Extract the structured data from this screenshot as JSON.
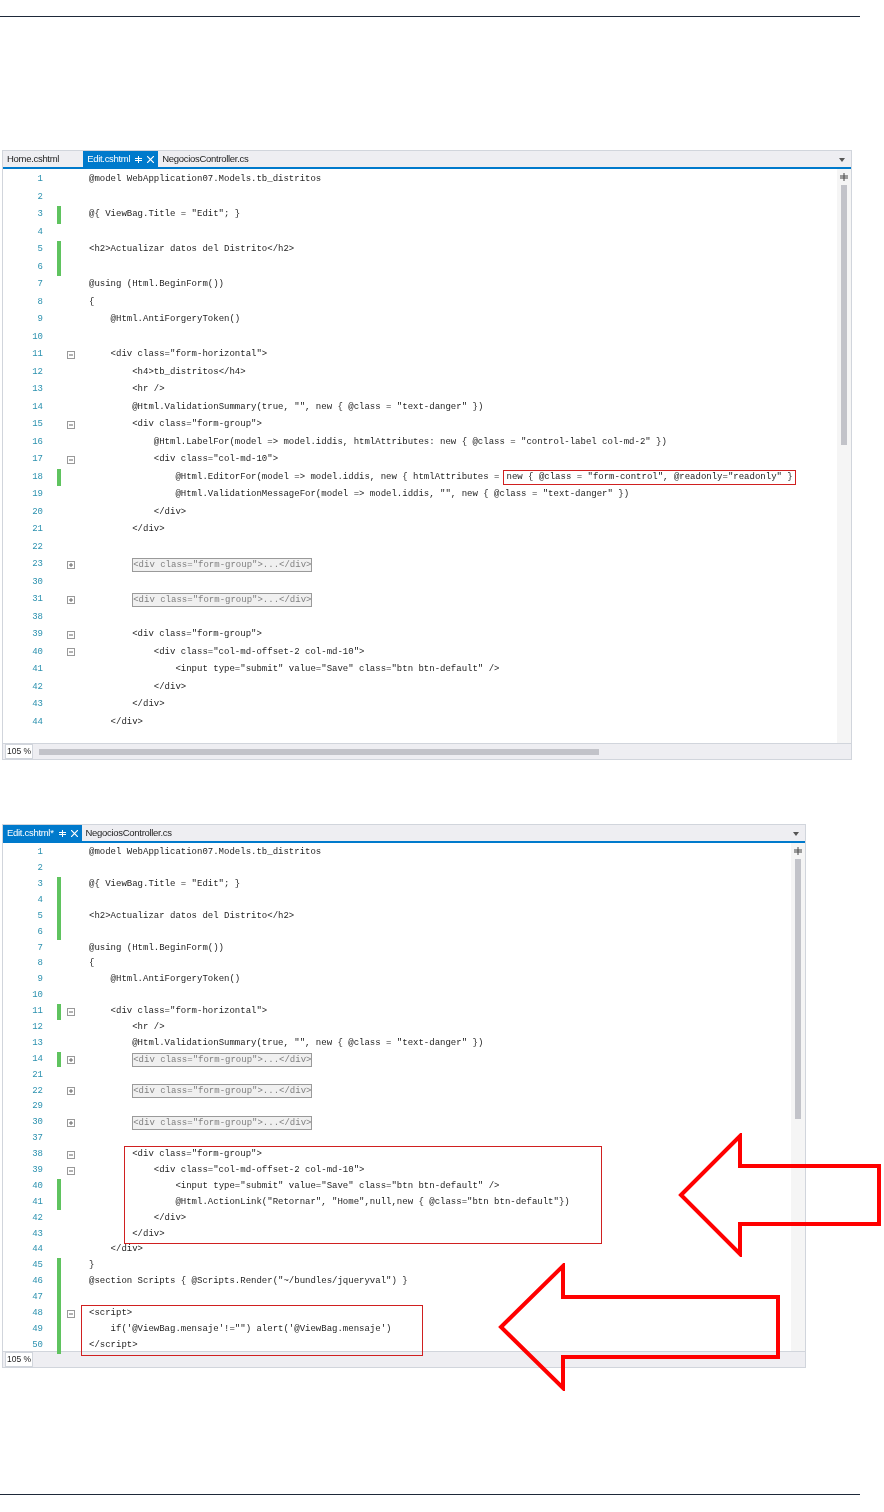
{
  "editors": [
    {
      "tabs": [
        {
          "label": "Home.cshtml",
          "selected": false
        },
        {
          "label": "Edit.cshtml",
          "selected": true
        },
        {
          "label": "NegociosController.cs",
          "selected": false
        }
      ],
      "lines": [
        {
          "num": "1",
          "text": "@model WebApplication07.Models.tb_distritos",
          "changed": false,
          "boxed": false
        },
        {
          "num": "2",
          "changed": false,
          "boxed": false
        },
        {
          "num": "3",
          "text": "@{ ViewBag.Title = \"Edit\"; }",
          "changed": true,
          "boxed": false
        },
        {
          "num": "4",
          "changed": false,
          "boxed": false
        },
        {
          "num": "5",
          "text": "<h2>Actualizar datos del Distrito</h2>",
          "changed": true,
          "boxed": false
        },
        {
          "num": "6",
          "changed": true,
          "boxed": false
        },
        {
          "num": "7",
          "text": "@using (Html.BeginForm())",
          "changed": false,
          "boxed": false
        },
        {
          "num": "8",
          "text": "{",
          "changed": false,
          "boxed": false
        },
        {
          "num": "9",
          "text": "    @Html.AntiForgeryToken()",
          "changed": false,
          "boxed": false
        },
        {
          "num": "10",
          "changed": false,
          "boxed": false
        },
        {
          "num": "11",
          "text": "    <div class=\"form-horizontal\">",
          "changed": false,
          "collapsed": false,
          "boxed": false
        },
        {
          "num": "12",
          "text": "        <h4>tb_distritos</h4>",
          "changed": false,
          "boxed": false
        },
        {
          "num": "13",
          "text": "        <hr />",
          "changed": false,
          "boxed": false
        },
        {
          "num": "14",
          "text": "        @Html.ValidationSummary(true, \"\", new { @class = \"text-danger\" })",
          "changed": false,
          "boxed": false
        },
        {
          "num": "15",
          "text": "        <div class=\"form-group\">",
          "changed": false,
          "collapsed": false,
          "boxed": false
        },
        {
          "num": "16",
          "text": "            @Html.LabelFor(model => model.iddis, htmlAttributes: new { @class = \"control-label col-md-2\" })",
          "changed": false,
          "boxed": false
        },
        {
          "num": "17",
          "text": "            <div class=\"col-md-10\">",
          "changed": false,
          "collapsed": false,
          "boxed": false
        },
        {
          "num": "18",
          "text": "                @Html.EditorFor(model => model.iddis, new { htmlAttributes =",
          "boxed_text": "new { @class = \"form-control\", @readonly=\"readonly\" }",
          "changed": true,
          "boxed": false
        },
        {
          "num": "19",
          "text": "                @Html.ValidationMessageFor(model => model.iddis, \"\", new { @class = \"text-danger\" })",
          "changed": false,
          "boxed": false
        },
        {
          "num": "20",
          "text": "            </div>",
          "changed": false,
          "boxed": false
        },
        {
          "num": "21",
          "text": "        </div>",
          "changed": false,
          "boxed": false
        },
        {
          "num": "22",
          "changed": false,
          "boxed": false
        },
        {
          "num": "23",
          "text": "        <div class=\"form-group\">...</div>",
          "changed": false,
          "collapsed": true,
          "boxed": false
        },
        {
          "num": "30",
          "changed": false,
          "boxed": false
        },
        {
          "num": "31",
          "text": "        <div class=\"form-group\">...</div>",
          "changed": false,
          "collapsed": true,
          "boxed": false
        },
        {
          "num": "38",
          "changed": false,
          "boxed": false
        },
        {
          "num": "39",
          "text": "        <div class=\"form-group\">",
          "changed": false,
          "collapsed": false,
          "boxed": false
        },
        {
          "num": "40",
          "text": "            <div class=\"col-md-offset-2 col-md-10\">",
          "changed": false,
          "collapsed": false,
          "boxed": false
        },
        {
          "num": "41",
          "text": "                <input type=\"submit\" value=\"Save\" class=\"btn btn-default\" />",
          "changed": false,
          "boxed": false
        },
        {
          "num": "42",
          "text": "            </div>",
          "changed": false,
          "boxed": false
        },
        {
          "num": "43",
          "text": "        </div>",
          "changed": false,
          "boxed": false
        },
        {
          "num": "44",
          "text": "    </div>",
          "changed": false,
          "boxed": false
        }
      ],
      "zoom": "105 %"
    },
    {
      "tabs": [
        {
          "label": "Edit.cshtml*",
          "selected": true
        },
        {
          "label": "NegociosController.cs",
          "selected": false
        }
      ],
      "lines": [
        {
          "num": "1",
          "text": "@model WebApplication07.Models.tb_distritos",
          "changed": false,
          "boxed": false
        },
        {
          "num": "2",
          "changed": false,
          "boxed": false
        },
        {
          "num": "3",
          "text": "@{ ViewBag.Title = \"Edit\"; }",
          "changed": true,
          "boxed": false
        },
        {
          "num": "4",
          "changed": true,
          "boxed": false
        },
        {
          "num": "5",
          "text": "<h2>Actualizar datos del Distrito</h2>",
          "changed": true,
          "boxed": false
        },
        {
          "num": "6",
          "changed": true,
          "boxed": false
        },
        {
          "num": "7",
          "text": "@using (Html.BeginForm())",
          "changed": false,
          "boxed": false
        },
        {
          "num": "8",
          "text": "{",
          "changed": false,
          "boxed": false
        },
        {
          "num": "9",
          "text": "    @Html.AntiForgeryToken()",
          "changed": false,
          "boxed": false
        },
        {
          "num": "10",
          "changed": false,
          "boxed": false
        },
        {
          "num": "11",
          "text": "    <div class=\"form-horizontal\">",
          "changed": true,
          "collapsed": false,
          "boxed": false
        },
        {
          "num": "12",
          "text": "        <hr />",
          "changed": false,
          "boxed": false
        },
        {
          "num": "13",
          "text": "        @Html.ValidationSummary(true, \"\", new { @class = \"text-danger\" })",
          "changed": false,
          "boxed": false
        },
        {
          "num": "14",
          "text": "        <div class=\"form-group\">...</div>",
          "changed": true,
          "collapsed": true,
          "boxed": false
        },
        {
          "num": "21",
          "changed": false,
          "boxed": false
        },
        {
          "num": "22",
          "text": "        <div class=\"form-group\">...</div>",
          "changed": false,
          "collapsed": true,
          "boxed": false
        },
        {
          "num": "29",
          "changed": false,
          "boxed": false
        },
        {
          "num": "30",
          "text": "        <div class=\"form-group\">...</div>",
          "changed": false,
          "collapsed": true,
          "boxed": false
        },
        {
          "num": "37",
          "changed": false,
          "boxed": false
        },
        {
          "num": "38",
          "text": "        <div class=\"form-group\">",
          "changed": false,
          "collapsed": false,
          "boxed": true
        },
        {
          "num": "39",
          "text": "            <div class=\"col-md-offset-2 col-md-10\">",
          "changed": false,
          "collapsed": false,
          "boxed": true
        },
        {
          "num": "40",
          "text": "                <input type=\"submit\" value=\"Save\" class=\"btn btn-default\" />",
          "changed": true,
          "boxed": true
        },
        {
          "num": "41",
          "text": "                @Html.ActionLink(\"Retornar\", \"Home\",null,new { @class=\"btn btn-default\"})",
          "changed": true,
          "boxed": true
        },
        {
          "num": "42",
          "text": "            </div>",
          "changed": false,
          "boxed": true
        },
        {
          "num": "43",
          "text": "        </div>",
          "changed": false,
          "boxed": true
        },
        {
          "num": "44",
          "text": "    </div>",
          "changed": false,
          "boxed": false
        },
        {
          "num": "45",
          "text": "}",
          "changed": true,
          "boxed": false
        },
        {
          "num": "46",
          "text": "@section Scripts { @Scripts.Render(\"~/bundles/jqueryval\") }",
          "changed": true,
          "boxed": false
        },
        {
          "num": "47",
          "changed": true,
          "boxed": false
        },
        {
          "num": "48",
          "text": "<script>",
          "changed": true,
          "collapsed": false,
          "boxed": true
        },
        {
          "num": "49",
          "text": "    if('@ViewBag.mensaje'!=\"\") alert('@ViewBag.mensaje')",
          "changed": true,
          "boxed": true
        },
        {
          "num": "50",
          "text": "</script>",
          "changed": true,
          "boxed": true
        }
      ],
      "zoom": "105 %"
    }
  ]
}
